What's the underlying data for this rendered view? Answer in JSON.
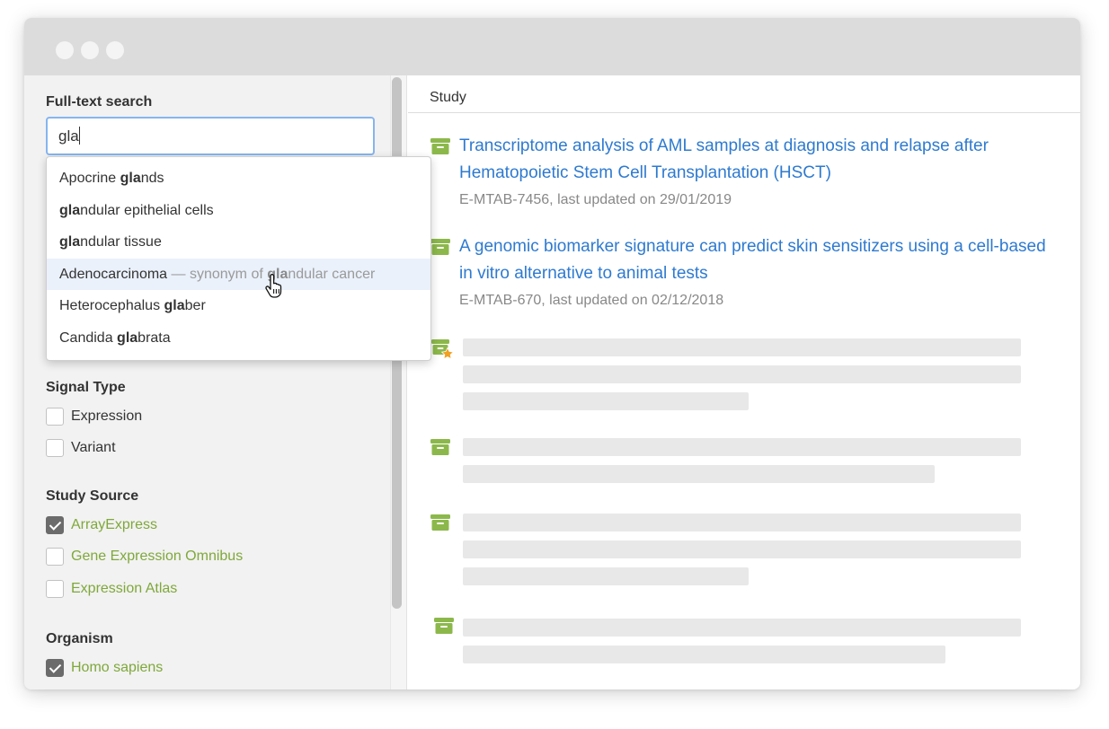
{
  "window": {
    "traffic_lights": [
      "close",
      "minimize",
      "zoom"
    ]
  },
  "sidebar": {
    "fulltext": {
      "title": "Full-text search",
      "value": "gla"
    },
    "suggestions": [
      {
        "pre": "Apocrine ",
        "match": "gla",
        "post": "nds",
        "syn_note": "",
        "syn_pre": "",
        "syn_match": "",
        "syn_post": "",
        "highlighted": false
      },
      {
        "pre": "",
        "match": "gla",
        "post": "ndular epithelial cells",
        "syn_note": "",
        "syn_pre": "",
        "syn_match": "",
        "syn_post": "",
        "highlighted": false
      },
      {
        "pre": "",
        "match": "gla",
        "post": "ndular tissue",
        "syn_note": "",
        "syn_pre": "",
        "syn_match": "",
        "syn_post": "",
        "highlighted": false
      },
      {
        "pre": "Adenocarcinoma",
        "match": "",
        "post": "",
        "syn_note": "yes",
        "syn_pre": " — synonym of ",
        "syn_match": "gla",
        "syn_post": "ndular cancer",
        "highlighted": true
      },
      {
        "pre": "Heterocephalus ",
        "match": "gla",
        "post": "ber",
        "syn_note": "",
        "syn_pre": "",
        "syn_match": "",
        "syn_post": "",
        "highlighted": false
      },
      {
        "pre": "Candida ",
        "match": "gla",
        "post": "brata",
        "syn_note": "",
        "syn_pre": "",
        "syn_match": "",
        "syn_post": "",
        "highlighted": false
      }
    ],
    "signal_type": {
      "title": "Signal Type",
      "options": [
        {
          "label": "Expression",
          "checked": false
        },
        {
          "label": "Variant",
          "checked": false
        }
      ]
    },
    "study_source": {
      "title": "Study Source",
      "options": [
        {
          "label": "ArrayExpress",
          "checked": true
        },
        {
          "label": "Gene Expression Omnibus",
          "checked": false
        },
        {
          "label": "Expression Atlas",
          "checked": false
        }
      ]
    },
    "organism": {
      "title": "Organism",
      "options": [
        {
          "label": "Homo sapiens",
          "checked": true
        }
      ]
    }
  },
  "main": {
    "header": "Study",
    "studies": [
      {
        "title": "Transcriptome analysis of AML samples at diagnosis and relapse after Hematopoietic Stem Cell Transplantation (HSCT)",
        "meta": "E-MTAB-7456, last updated on 29/01/2019",
        "icon": "archive-box-icon"
      },
      {
        "title": "A genomic biomarker signature can predict skin sensitizers using a cell-based in vitro alternative to animal tests",
        "meta": "E-MTAB-670, last updated on 02/12/2018",
        "icon": "archive-box-icon"
      }
    ],
    "placeholder_icons": [
      "archive-box-star-icon",
      "archive-box-icon",
      "archive-box-icon",
      "archive-box-icon"
    ]
  },
  "colors": {
    "accent_green": "#7fa83a",
    "link_blue": "#2e7ad0",
    "input_focus": "#86b5ef",
    "star": "#f0a023"
  }
}
